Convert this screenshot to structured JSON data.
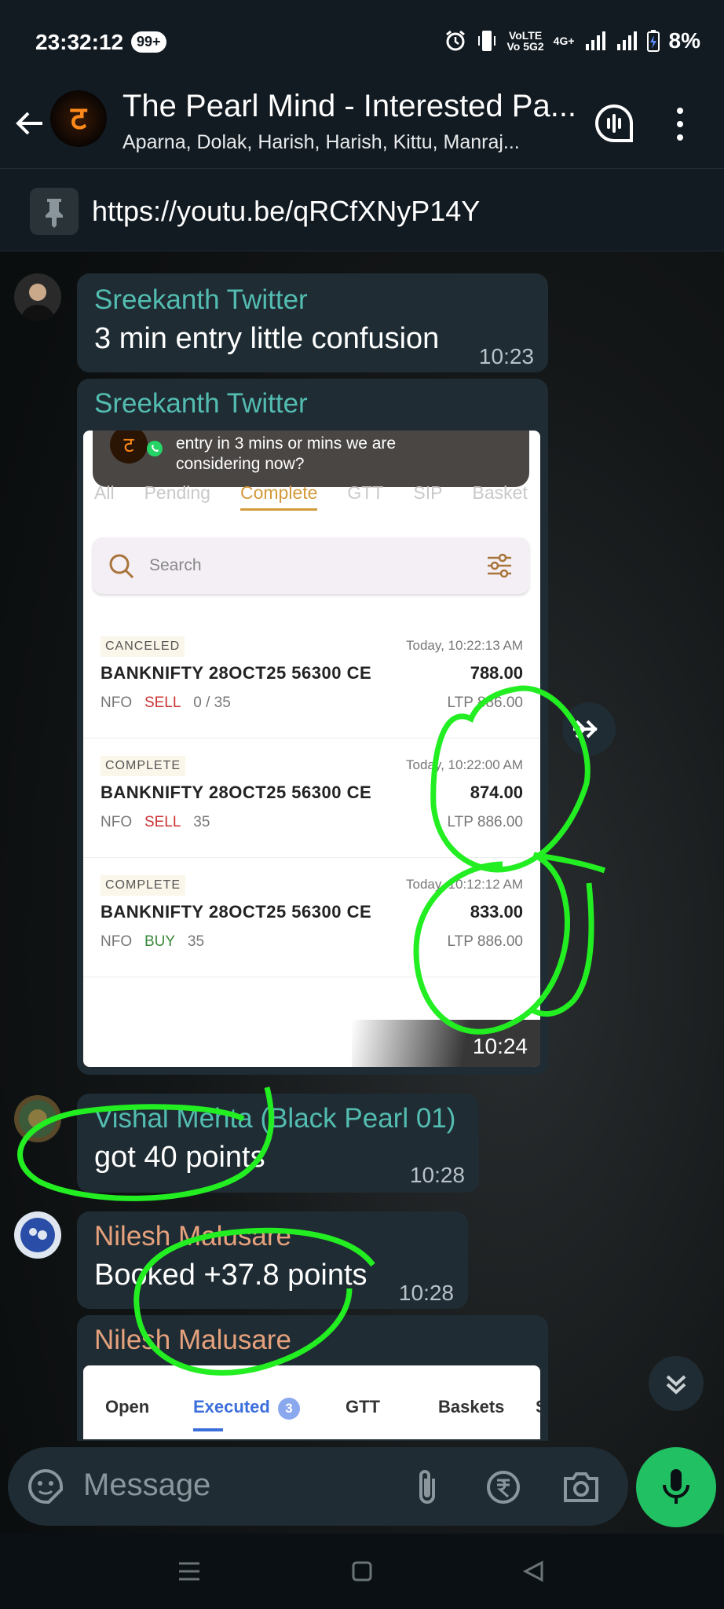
{
  "status_bar": {
    "time": "23:32:12",
    "notif_badge": "99+",
    "volte": "VoLTE",
    "vo5g": "Vo 5G2",
    "net": "4G+",
    "battery": "8%"
  },
  "header": {
    "group_name": "The Pearl Mind - Interested Pa...",
    "members": "Aparna, Dolak, Harish, Harish, Kittu, Manraj...",
    "avatar_glyph": "ट"
  },
  "pinned": {
    "url": "https://youtu.be/qRCfXNyP14Y"
  },
  "messages": [
    {
      "sender": "Sreekanth Twitter",
      "text": "3 min entry little confusion",
      "time": "10:23",
      "color": "#53bdb1"
    },
    {
      "sender": "Sreekanth Twitter",
      "time": "10:24",
      "color": "#53bdb1"
    },
    {
      "sender": "Vishal Mehta (Black Pearl 01)",
      "text": "got 40 points",
      "time": "10:28",
      "color": "#53bdb1"
    },
    {
      "sender": "Nilesh Malusare",
      "text": "Booked +37.8 points",
      "time": "10:28",
      "color": "#e6a17d"
    },
    {
      "sender": "Nilesh Malusare",
      "color": "#e6a17d"
    }
  ],
  "screenshot1": {
    "notification": "entry in 3 mins or  mins we are considering now?",
    "tabs": [
      "All",
      "Pending",
      "Complete",
      "GTT",
      "SIP",
      "Basket"
    ],
    "active_tab": "Complete",
    "search_placeholder": "Search",
    "orders": [
      {
        "status": "CANCELED",
        "date": "Today, 10:22:13 AM",
        "symbol": "BANKNIFTY 28OCT25 56300 CE",
        "price": "788.00",
        "exchange": "NFO",
        "side": "SELL",
        "qty": "0 / 35",
        "ltp": "LTP  886.00"
      },
      {
        "status": "COMPLETE",
        "date": "Today, 10:22:00 AM",
        "symbol": "BANKNIFTY 28OCT25 56300 CE",
        "price": "874.00",
        "exchange": "NFO",
        "side": "SELL",
        "qty": "35",
        "ltp": "LTP  886.00"
      },
      {
        "status": "COMPLETE",
        "date": "Today, 10:12:12 AM",
        "symbol": "BANKNIFTY 28OCT25 56300 CE",
        "price": "833.00",
        "exchange": "NFO",
        "side": "BUY",
        "qty": "35",
        "ltp": "LTP  886.00"
      }
    ]
  },
  "screenshot2": {
    "tabs": [
      "Open",
      "Executed",
      "GTT",
      "Baskets",
      "S"
    ],
    "active_tab": "Executed",
    "executed_count": "3"
  },
  "compose": {
    "placeholder": "Message"
  },
  "colors": {
    "bubble": "#1f2c33",
    "mic": "#21c063",
    "annotation": "#22ee22"
  }
}
